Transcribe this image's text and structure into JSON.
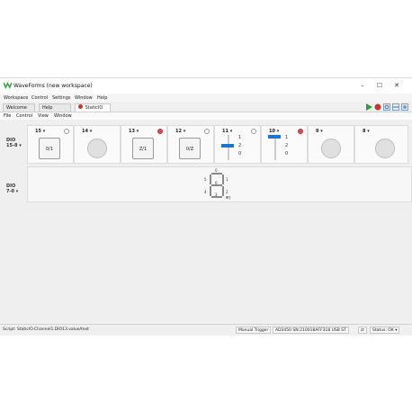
{
  "window": {
    "title": "WaveForms (new workspace)",
    "minimize": "–",
    "maximize": "☐",
    "close": "✕"
  },
  "menu": [
    "Workspace",
    "Control",
    "Settings",
    "Window",
    "Help"
  ],
  "tabs": [
    {
      "label": "Welcome"
    },
    {
      "label": "Help"
    },
    {
      "label": "StaticIO"
    }
  ],
  "submenu": [
    "File",
    "Control",
    "View",
    "Window"
  ],
  "groups": [
    {
      "label_top": "DIO",
      "label_bottom": "15-8"
    },
    {
      "label_top": "DIO",
      "label_bottom": "7-0"
    }
  ],
  "io": [
    {
      "label": "15",
      "type": "button",
      "text": "0/1",
      "status": "off"
    },
    {
      "label": "14",
      "type": "led",
      "status": "none"
    },
    {
      "label": "13",
      "type": "button",
      "text": "Z/1",
      "status": "red"
    },
    {
      "label": "12",
      "type": "button",
      "text": "0/Z",
      "status": "off"
    },
    {
      "label": "11",
      "type": "slider",
      "ticks": [
        "1",
        "2",
        "0"
      ],
      "status": "off"
    },
    {
      "label": "10",
      "type": "slider",
      "ticks": [
        "1",
        "2",
        "0"
      ],
      "status": "red"
    },
    {
      "label": "9",
      "type": "led",
      "status": "none"
    },
    {
      "label": "8",
      "type": "led",
      "status": "none"
    }
  ],
  "seven_segment": {
    "labels": [
      "0",
      "5",
      "1",
      "6",
      "4",
      "2",
      "3",
      "7"
    ]
  },
  "statusbar": {
    "script": "Script: StaticIO.Channel1.DIO13.value/text",
    "trigger": "Manual Trigger",
    "device": "AD3450 SN:210018AFF318 USB ST",
    "status": "Status: OK"
  }
}
